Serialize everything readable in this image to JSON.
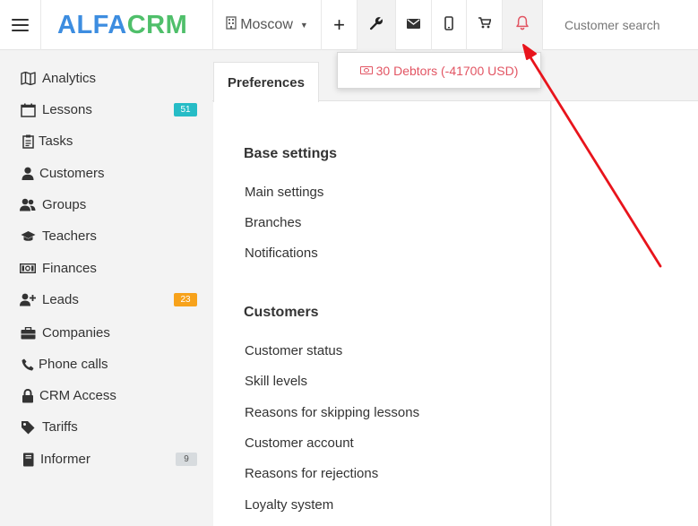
{
  "header": {
    "logo_part1": "ALFA",
    "logo_part2": "CRM",
    "branch": "Moscow",
    "search_placeholder": "Customer search"
  },
  "notification": {
    "text": "30 Debtors (-41700 USD)"
  },
  "sidebar": {
    "items": [
      {
        "label": "Analytics",
        "icon": "analytics-icon"
      },
      {
        "label": "Lessons",
        "icon": "calendar-icon",
        "badge": "51"
      },
      {
        "label": "Tasks",
        "icon": "clipboard-icon"
      },
      {
        "label": "Customers",
        "icon": "user-icon"
      },
      {
        "label": "Groups",
        "icon": "users-icon"
      },
      {
        "label": "Teachers",
        "icon": "graduation-cap-icon"
      },
      {
        "label": "Finances",
        "icon": "money-icon"
      },
      {
        "label": "Leads",
        "icon": "user-plus-icon",
        "badge": "23"
      },
      {
        "label": "Companies",
        "icon": "briefcase-icon"
      },
      {
        "label": "Phone calls",
        "icon": "phone-icon"
      },
      {
        "label": "CRM Access",
        "icon": "lock-icon"
      },
      {
        "label": "Tariffs",
        "icon": "tag-icon"
      },
      {
        "label": "Informer",
        "icon": "book-icon",
        "badge": "9"
      }
    ]
  },
  "tabs": {
    "active": "Preferences"
  },
  "settings": {
    "sections": [
      {
        "title": "Base settings",
        "links": [
          "Main settings",
          "Branches",
          "Notifications"
        ]
      },
      {
        "title": "Customers",
        "links": [
          "Customer status",
          "Skill levels",
          "Reasons for skipping lessons",
          "Customer account",
          "Reasons for rejections",
          "Loyalty system"
        ]
      }
    ]
  },
  "colors": {
    "logo_blue": "#3d8de0",
    "logo_green": "#4fbf6a",
    "alert_red": "#e25563",
    "badge_teal": "#26bcc6",
    "badge_orange": "#f7a21b",
    "arrow_red": "#e8141c"
  }
}
